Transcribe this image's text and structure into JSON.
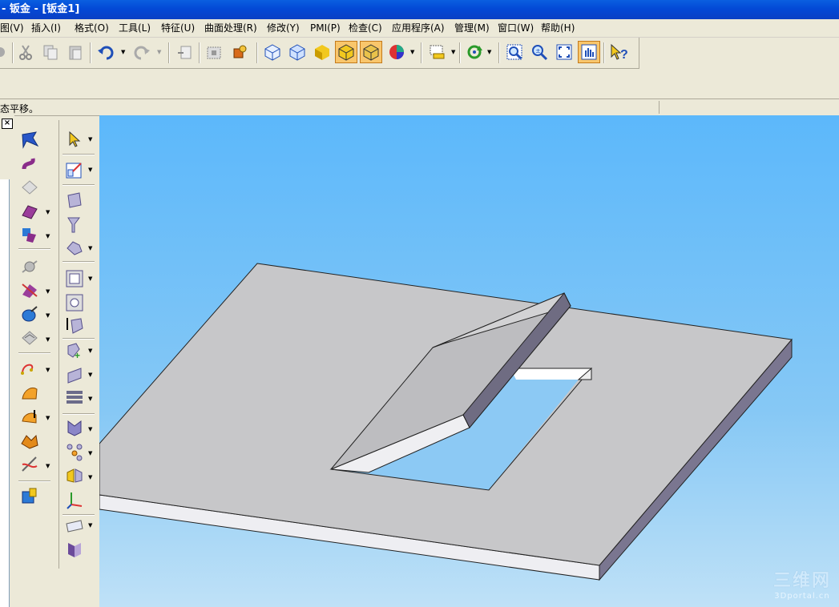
{
  "window": {
    "title": "- 钣金 - [钣金1]"
  },
  "menu": [
    {
      "label": "图(V)"
    },
    {
      "label": "插入(I)"
    },
    {
      "label": "格式(O)"
    },
    {
      "label": "工具(L)"
    },
    {
      "label": "特征(U)"
    },
    {
      "label": "曲面处理(R)"
    },
    {
      "label": "修改(Y)"
    },
    {
      "label": "PMI(P)"
    },
    {
      "label": "检查(C)"
    },
    {
      "label": "应用程序(A)"
    },
    {
      "label": "管理(M)"
    },
    {
      "label": "窗口(W)"
    },
    {
      "label": "帮助(H)"
    }
  ],
  "status": {
    "message": "态平移。"
  },
  "panel": {
    "close_glyph": "×"
  },
  "watermark": {
    "brand": "三维网",
    "url": "3Dportal.cn"
  },
  "toolbar": {
    "buttons": [
      "cut-icon",
      "copy-icon",
      "paste-icon",
      "undo-icon",
      "redo-icon",
      "clipboard-icon",
      "capture-icon",
      "render-icon",
      "iso-view-icon",
      "wireframe-box-icon",
      "shaded-box-icon",
      "shaded-edges-icon",
      "hidden-lines-icon",
      "color-sphere-icon",
      "select-filter-icon",
      "rotate-view-icon",
      "zoom-area-icon",
      "zoom-icon",
      "fit-all-icon",
      "pan-icon",
      "help-pointer-icon"
    ],
    "pressed": [
      "shaded-edges-icon",
      "hidden-lines-icon",
      "pan-icon"
    ]
  },
  "colors": {
    "title_bar": "#0349d6",
    "viewport_top": "#5cb8fb",
    "viewport_bottom": "#bfe1f7",
    "pressed": "#f9c66b"
  }
}
